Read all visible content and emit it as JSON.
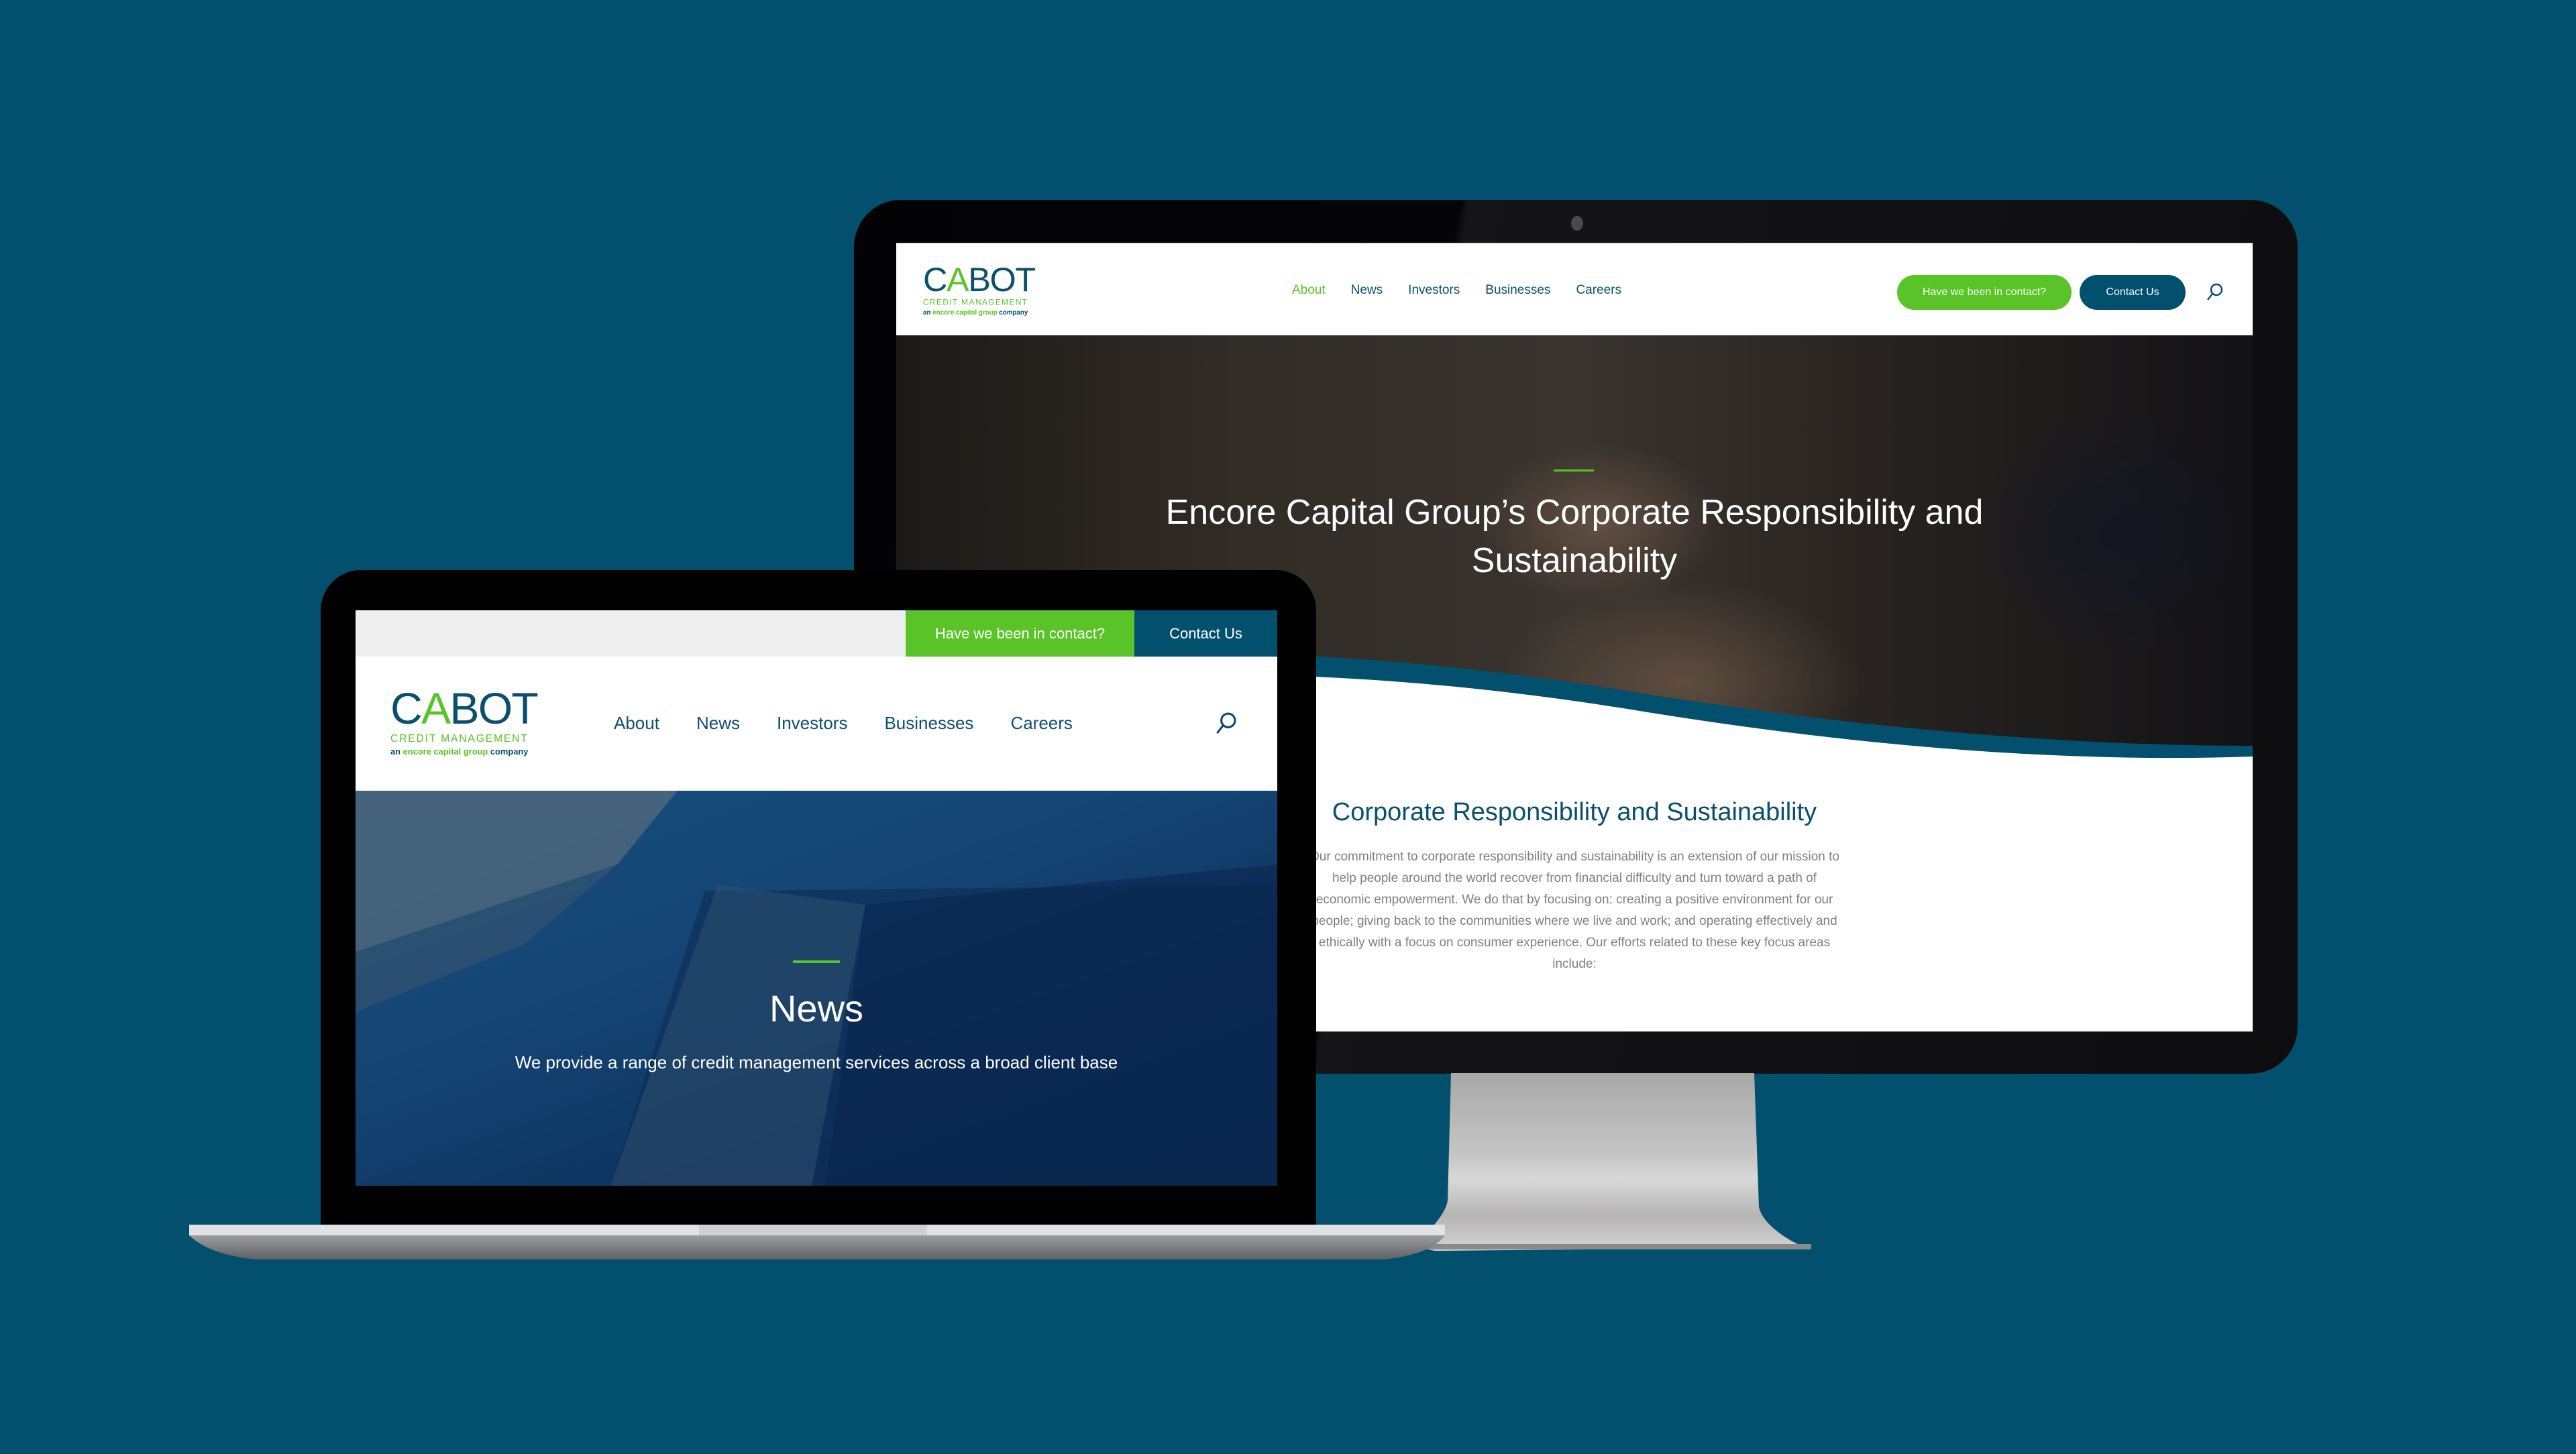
{
  "theme": {
    "background": "#02506e",
    "brand_blue": "#0b4f6e",
    "brand_green": "#59c327",
    "button_blue": "#02506e"
  },
  "monitor": {
    "logo": {
      "wordmark_prefix": "C",
      "wordmark_accent": "A",
      "wordmark_suffix": "BOT",
      "subtitle": "CREDIT MANAGEMENT",
      "tagline_prefix": "an ",
      "tagline_accent": "encore capital group",
      "tagline_suffix": " company"
    },
    "nav": [
      {
        "label": "About",
        "active": true
      },
      {
        "label": "News",
        "active": false
      },
      {
        "label": "Investors",
        "active": false
      },
      {
        "label": "Businesses",
        "active": false
      },
      {
        "label": "Careers",
        "active": false
      }
    ],
    "buttons": {
      "have_we_been_in_contact": "Have we been in contact?",
      "contact_us": "Contact Us"
    },
    "search_icon": "search-icon",
    "hero": {
      "title": "Encore Capital Group’s Corporate Responsibility and Sustainability"
    },
    "section": {
      "title": "Corporate Responsibility and Sustainability",
      "body": "Our commitment to corporate responsibility and sustainability is an extension of our mission to help people around the world recover from financial difficulty and turn toward a path of economic empowerment. We do that by focusing on: creating a positive environment for our people; giving back to the communities where we live and work; and operating effectively and ethically with a focus on consumer experience. Our efforts related to these key focus areas include:"
    }
  },
  "laptop": {
    "topbar": {
      "have_we_been_in_contact": "Have we been in contact?",
      "contact_us": "Contact Us"
    },
    "logo": {
      "wordmark_prefix": "C",
      "wordmark_accent": "A",
      "wordmark_suffix": "BOT",
      "subtitle": "CREDIT MANAGEMENT",
      "tagline_prefix": "an ",
      "tagline_accent": "encore capital group",
      "tagline_suffix": " company"
    },
    "nav": [
      {
        "label": "About"
      },
      {
        "label": "News"
      },
      {
        "label": "Investors"
      },
      {
        "label": "Businesses"
      },
      {
        "label": "Careers"
      }
    ],
    "search_icon": "search-icon",
    "hero": {
      "title": "News",
      "subtitle": "We provide a range of credit management services across a broad client base"
    }
  }
}
